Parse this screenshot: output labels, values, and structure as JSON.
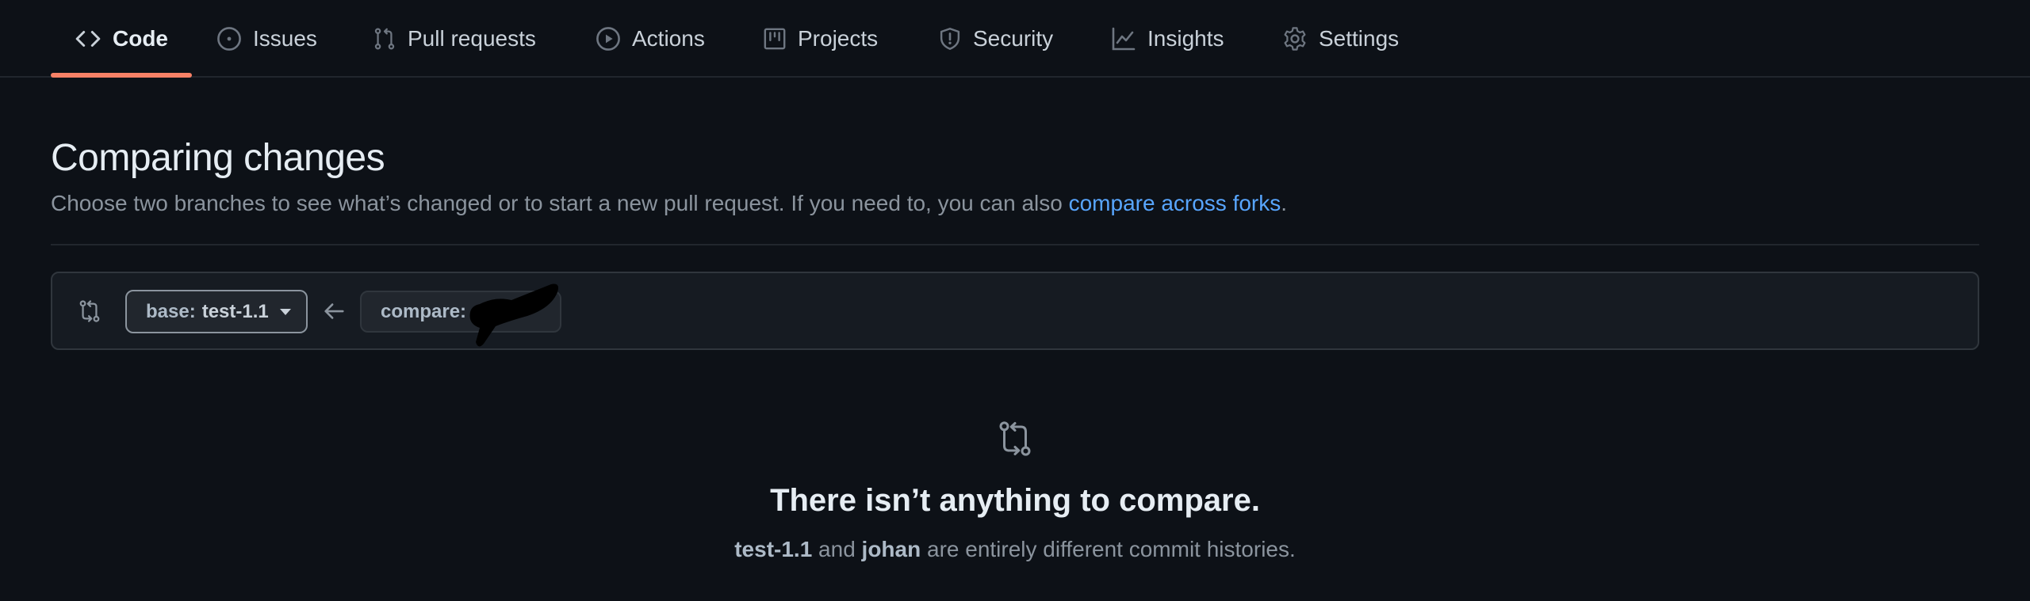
{
  "nav": {
    "tabs": [
      {
        "label": "Code",
        "icon": "code-icon",
        "active": true
      },
      {
        "label": "Issues",
        "icon": "issue-opened-icon",
        "active": false
      },
      {
        "label": "Pull requests",
        "icon": "git-pull-request-icon",
        "active": false
      },
      {
        "label": "Actions",
        "icon": "play-icon",
        "active": false
      },
      {
        "label": "Projects",
        "icon": "project-icon",
        "active": false
      },
      {
        "label": "Security",
        "icon": "shield-icon",
        "active": false
      },
      {
        "label": "Insights",
        "icon": "graph-icon",
        "active": false
      },
      {
        "label": "Settings",
        "icon": "gear-icon",
        "active": false
      }
    ],
    "active_color": "#f78166"
  },
  "page": {
    "title": "Comparing changes",
    "subtitle_text": "Choose two branches to see what’s changed or to start a new pull request. If you need to, you can also ",
    "subtitle_link": "compare across forks",
    "subtitle_end": "."
  },
  "range": {
    "icon": "git-compare-icon",
    "base_prefix": "base:",
    "base_branch": "test-1.1",
    "arrow_icon": "arrow-left-icon",
    "compare_prefix": "compare:",
    "compare_branch_redacted": true
  },
  "blankslate": {
    "icon": "git-compare-icon",
    "title": "There isn’t anything to compare.",
    "desc_branch_a": "test-1.1",
    "desc_and": " and ",
    "desc_branch_b": "johan",
    "desc_rest": " are entirely different commit histories."
  },
  "colors": {
    "background": "#0d1117",
    "link": "#58a6ff",
    "muted": "#8b949e"
  }
}
